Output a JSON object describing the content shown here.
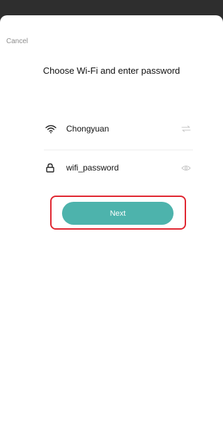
{
  "header": {
    "cancel_label": "Cancel",
    "title": "Choose Wi-Fi and enter password"
  },
  "wifi": {
    "ssid": "Chongyuan",
    "lead_icon": "wifi-icon",
    "trail_icon": "switch-network-icon"
  },
  "password": {
    "value": "wifi_password",
    "lead_icon": "lock-icon",
    "trail_icon": "eye-icon"
  },
  "actions": {
    "next_label": "Next"
  },
  "colors": {
    "accent": "#4db3ac",
    "highlight": "#e0242f",
    "backdrop": "#2e2e2e"
  }
}
